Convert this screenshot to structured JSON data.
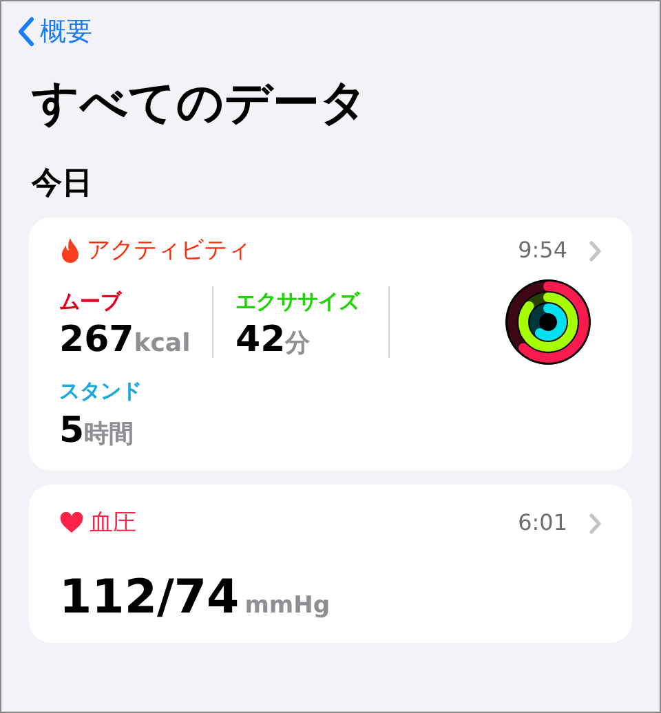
{
  "nav": {
    "back_label": "概要"
  },
  "title": "すべてのデータ",
  "section": "今日",
  "activity": {
    "title": "アクティビティ",
    "time": "9:54",
    "metrics": [
      {
        "label": "ムーブ",
        "value": "267",
        "unit": "kcal",
        "color": "#e3001f"
      },
      {
        "label": "エクササイズ",
        "value": "42",
        "unit": "分",
        "color": "#1ed400"
      },
      {
        "label": "スタンド",
        "value": "5",
        "unit": "時間",
        "color": "#19a8d8"
      }
    ],
    "rings": [
      {
        "level": 0.62,
        "color": "#fa1b4e"
      },
      {
        "level": 0.86,
        "color": "#a6ff00"
      },
      {
        "level": 0.6,
        "color": "#00e0f0"
      }
    ]
  },
  "blood_pressure": {
    "title": "血圧",
    "time": "6:01",
    "value": "112/74",
    "unit": "mmHg"
  }
}
